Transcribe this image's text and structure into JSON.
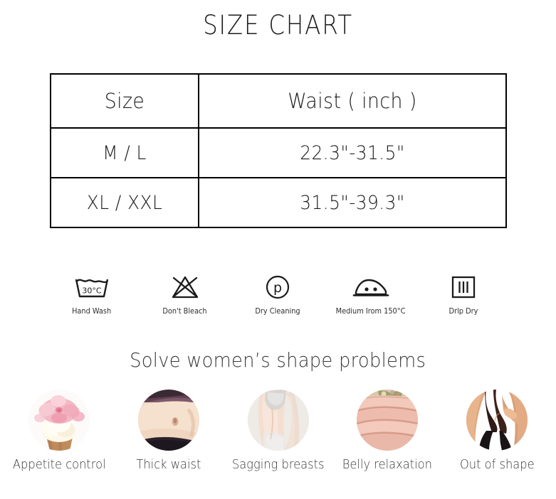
{
  "page": {
    "title": "SIZE CHART",
    "background_color": "#ffffff",
    "text_color": "#2b2b2b"
  },
  "size_table": {
    "columns": [
      "Size",
      "Waist ( inch )"
    ],
    "rows": [
      {
        "size": "M / L",
        "waist": "22.3\"-31.5\""
      },
      {
        "size": "XL / XXL",
        "waist": "31.5\"-39.3\""
      }
    ]
  },
  "care_instructions": [
    {
      "icon": "hand-wash-icon",
      "label": "Hand Wash",
      "temperature": "30°C"
    },
    {
      "icon": "do-not-bleach-icon",
      "label": "Don't Bleach"
    },
    {
      "icon": "dry-cleaning-icon",
      "label": "Dry Cleaning",
      "symbol": "p"
    },
    {
      "icon": "medium-iron-icon",
      "label": "Medium Irom 150°C"
    },
    {
      "icon": "drip-dry-icon",
      "label": "Drlp Dry"
    }
  ],
  "problems_section": {
    "heading": "Solve women’s shape problems",
    "items": [
      {
        "label": "Appetite control",
        "photo": "cupcake-with-pink-flower-photo"
      },
      {
        "label": "Thick waist",
        "photo": "female-midriff-photo"
      },
      {
        "label": "Sagging breasts",
        "photo": "side-torso-photo"
      },
      {
        "label": "Belly relaxation",
        "photo": "belly-fold-photo"
      },
      {
        "label": "Out of shape",
        "photo": "pinching-belly-photo"
      }
    ]
  }
}
